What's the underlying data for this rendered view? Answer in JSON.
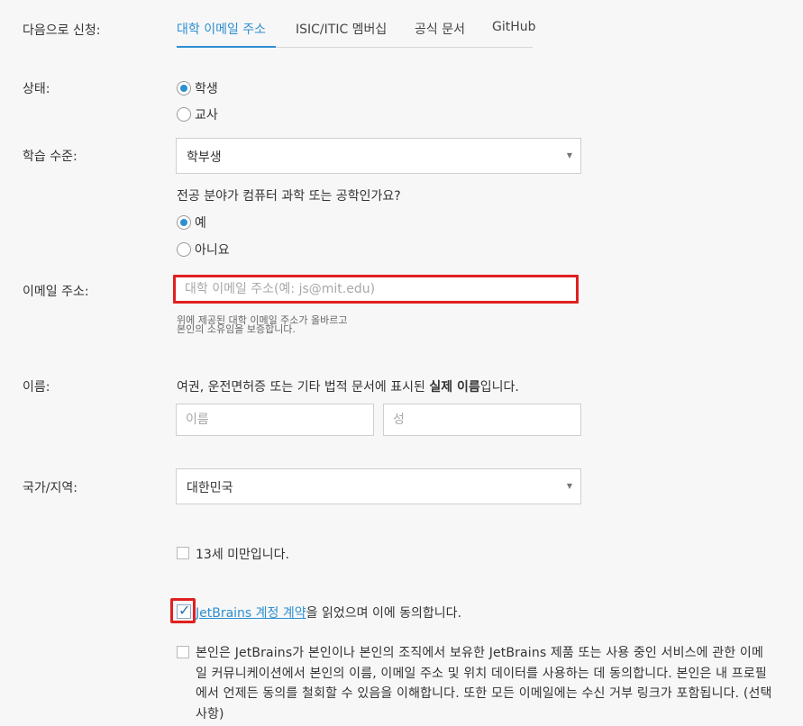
{
  "apply_with": {
    "label": "다음으로 신청:",
    "tabs": [
      "대학 이메일 주소",
      "ISIC/ITIC 멤버십",
      "공식 문서",
      "GitHub"
    ],
    "active_tab": 0
  },
  "status": {
    "label": "상태:",
    "options": [
      "학생",
      "교사"
    ],
    "selected": "학생"
  },
  "study_level": {
    "label": "학습 수준:",
    "value": "학부생"
  },
  "cs_major": {
    "question": "전공 분야가 컴퓨터 과학 또는 공학인가요?",
    "options": [
      "예",
      "아니요"
    ],
    "selected": "예"
  },
  "email": {
    "label": "이메일 주소:",
    "placeholder": "대학 이메일 주소(예: js@mit.edu)",
    "hint_line1": "위에 제공된 대학 이메일 주소가 올바르고",
    "hint_line2": "본인의 소유임을 보증합니다."
  },
  "name": {
    "label": "이름:",
    "note_before": "여권, 운전면허증 또는 기타 법적 문서에 표시된 ",
    "note_bold": "실제 이름",
    "note_after": "입니다.",
    "first_placeholder": "이름",
    "last_placeholder": "성"
  },
  "country": {
    "label": "국가/지역:",
    "value": "대한민국"
  },
  "under13": {
    "text": "13세 미만입니다.",
    "checked": false
  },
  "agreement": {
    "link_text": "JetBrains 계정 계약",
    "text_after": "을 읽었으며 이에 동의합니다.",
    "checked": true
  },
  "marketing": {
    "text": "본인은 JetBrains가 본인이나 본인의 조직에서 보유한 JetBrains 제품 또는 사용 중인 서비스에 관한 이메일 커뮤니케이션에서 본인의 이름, 이메일 주소 및 위치 데이터를 사용하는 데 동의합니다. 본인은 내 프로필에서 언제든 동의를 철회할 수 있음을 이해합니다. 또한 모든 이메일에는 수신 거부 링크가 포함됩니다. (선택 사항)",
    "checked": false
  },
  "icons": {
    "select_caret": "caret-down-icon",
    "checkmark": "checkmark-icon"
  },
  "colors": {
    "accent": "#2c8fd1",
    "highlight": "#e02020",
    "background": "#f7f7f7"
  }
}
